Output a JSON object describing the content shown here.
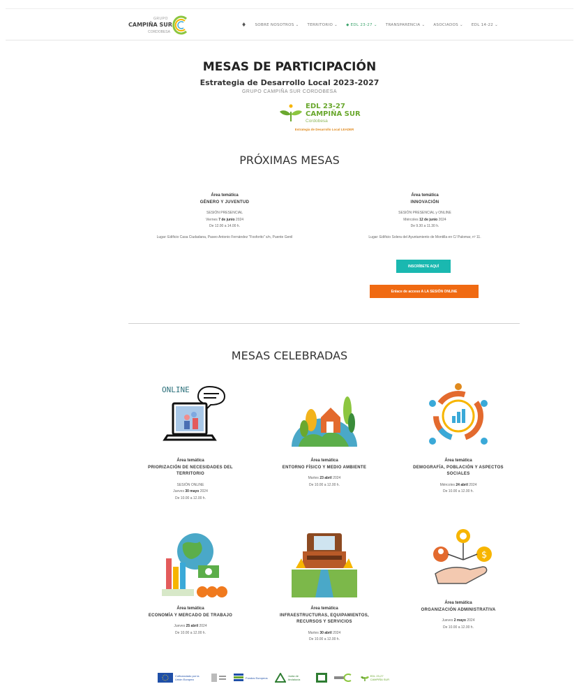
{
  "header": {
    "logo": {
      "top": "GRUPO",
      "brand": "CAMPIÑA SUR",
      "sub": "CORDOBESA"
    },
    "nav": [
      "SOBRE NOSOTROS ⌄",
      "TERRITORIO ⌄",
      "◆ EDL 23-27 ⌄",
      "TRANSPARENCIA ⌄",
      "ASOCIADOS ⌄",
      "EDL 14-22 ⌄"
    ]
  },
  "page": {
    "title": "MESAS DE PARTICIPACIÓN",
    "subtitle": "Estrategia de Desarrollo Local 2023-2027",
    "group": "GRUPO CAMPIÑA SUR CORDOBESA",
    "edl_logo": {
      "l1": "EDL 23-27",
      "l2": "CAMPIÑA SUR",
      "l3": "Cordobesa",
      "l4": "Estrategia de Desarrollo Local LEADER"
    }
  },
  "upcoming": {
    "heading": "PRÓXIMAS MESAS",
    "items": [
      {
        "area_label": "Área temática",
        "topic": "GÉNERO Y JUVENTUD",
        "mode": "SESIÓN PRESENCIAL",
        "day": "Viernes ",
        "date": "7 de junio",
        "year": " 2024",
        "time": "De 12.00 a 14.00 h.",
        "place": "Lugar: Edificio Casa Ciudadana, Paseo Antonio Fernández \"Fosforito\" s/n, Puente Genil"
      },
      {
        "area_label": "Área temática",
        "topic": "INNOVACIÓN",
        "mode": "SESIÓN PRESENCIAL y ONLINE",
        "day": "Miércoles ",
        "date": "12 de junio",
        "year": " 2024",
        "time": "De 9.30 a 11.30 h.",
        "place": "Lugar: Edificio Solera del Ayuntamiento de Montilla en C/ Palomar, nº 11."
      }
    ],
    "btn_register": "INSCRÍBETE AQUÍ",
    "btn_online": "Enlace de acceso A LA SESIÓN ONLINE"
  },
  "past": {
    "heading": "MESAS CELEBRADAS",
    "online_badge": "ONLINE",
    "cards": [
      {
        "area_label": "Área temática",
        "topic": "PRIORIZACIÓN DE NECESIDADES DEL TERRITORIO",
        "mode": "SESIÓN ONLINE",
        "day": "Jueves ",
        "date": "30 mayo",
        "year": " 2024",
        "time": "De 10.00 a 12.00 h."
      },
      {
        "area_label": "Área temática",
        "topic": "ENTORNO FÍSICO Y MEDIO AMBIENTE",
        "mode": "",
        "day": "Martes ",
        "date": "23 abril",
        "year": " 2024",
        "time": "De 10.00 a 12.00 h."
      },
      {
        "area_label": "Área temática",
        "topic": "DEMOGRAFÍA, POBLACIÓN Y ASPECTOS SOCIALES",
        "mode": "",
        "day": "Miércoles ",
        "date": "24 abril",
        "year": " 2024",
        "time": "De 10.00 a 12.00 h."
      },
      {
        "area_label": "Área temática",
        "topic": "ECONOMÍA Y MERCADO DE TRABAJO",
        "mode": "",
        "day": "Jueves ",
        "date": "25 abril",
        "year": " 2024",
        "time": "De 10.00 a 12.00 h."
      },
      {
        "area_label": "Área temática",
        "topic": "INFRAESTRUCTURAS, EQUIPAMIENTOS, RECURSOS Y SERVICIOS",
        "mode": "",
        "day": "Martes ",
        "date": "30 abril",
        "year": " 2024",
        "time": "De 10.00 a 12.00 h."
      },
      {
        "area_label": "Área temática",
        "topic": "ORGANIZACIÓN ADMINISTRATIVA",
        "mode": "",
        "day": "Jueves ",
        "date": "2 mayo",
        "year": " 2024",
        "time": "De 10.00 a 12.00 h."
      }
    ]
  },
  "footer": {
    "eu": "Cofinanciado por la Unión Europea",
    "fondos": "Fondos Europeos",
    "junta": "Junta de Andalucía",
    "edl": "EDL 23-27 CAMPIÑA SUR"
  },
  "colors": {
    "accent_green": "#1ab8b0",
    "accent_orange": "#f06a12",
    "brand_green": "#6aa82e"
  }
}
